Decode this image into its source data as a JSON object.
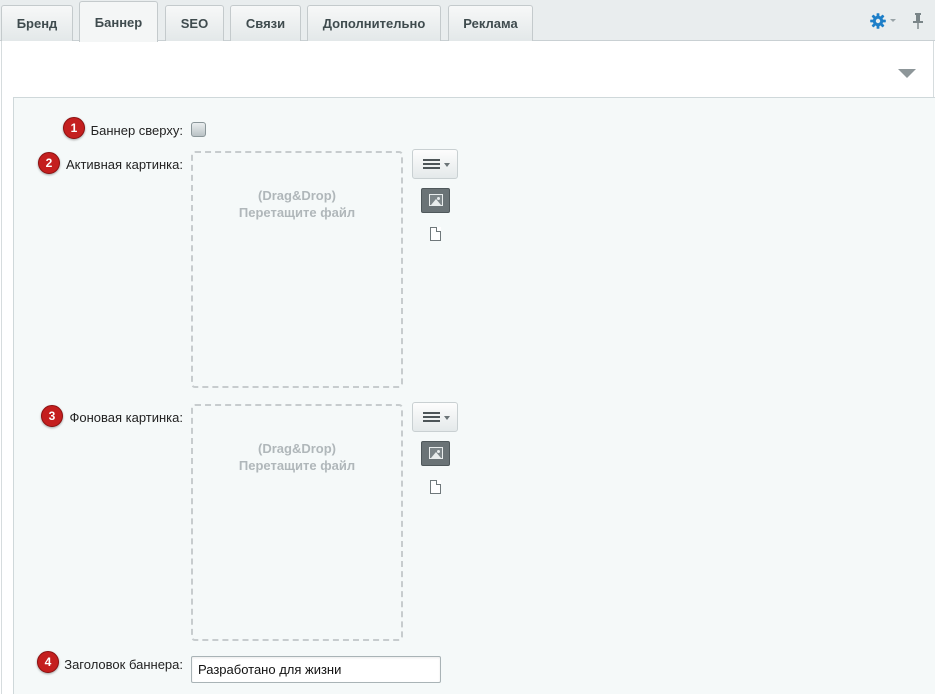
{
  "tabs": [
    {
      "label": "Бренд",
      "active": false
    },
    {
      "label": "Баннер",
      "active": true
    },
    {
      "label": "SEO",
      "active": false
    },
    {
      "label": "Связи",
      "active": false
    },
    {
      "label": "Дополнительно",
      "active": false
    },
    {
      "label": "Реклама",
      "active": false
    }
  ],
  "toolbar": {
    "settings_icon": "gear-icon",
    "pin_icon": "pin-icon",
    "accent_color": "#1e7fc8"
  },
  "form": {
    "banner_top": {
      "badge": "1",
      "label": "Баннер сверху:",
      "checked": false
    },
    "active_image": {
      "badge": "2",
      "label": "Активная картинка:",
      "drop_line1": "(Drag&Drop)",
      "drop_line2": "Перетащите файл"
    },
    "background_image": {
      "badge": "3",
      "label": "Фоновая картинка:",
      "drop_line1": "(Drag&Drop)",
      "drop_line2": "Перетащите файл"
    },
    "banner_title": {
      "badge": "4",
      "label": "Заголовок баннера:",
      "value": "Разработано для жизни"
    }
  },
  "colors": {
    "badge": "#c41f1f",
    "panel_bg": "#f5f9f9"
  }
}
